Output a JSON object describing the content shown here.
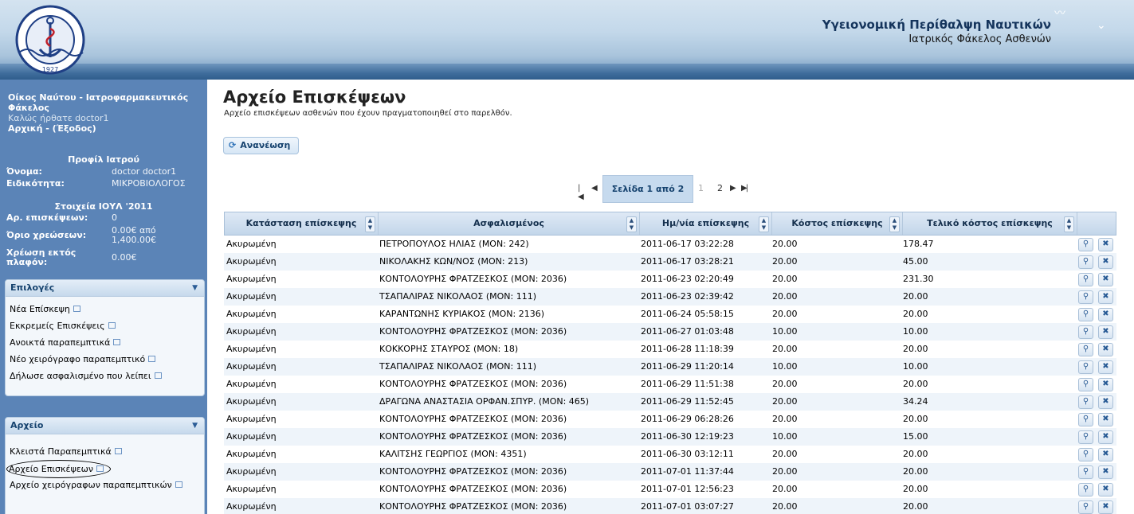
{
  "header": {
    "logo_text": "ΟΙΚΟΣ ΝΑΥΤΟΥ",
    "logo_year": "1927",
    "title": "Υγειονομική Περίθαλψη Ναυτικών",
    "subtitle": "Ιατρικός Φάκελος Ασθενών"
  },
  "sidebar": {
    "app_name": "Οίκος Ναύτου - Ιατροφαρμακευτικός Φάκελος",
    "welcome": "Καλώς ήρθατε doctor1",
    "home_link": "Αρχική",
    "logout_link": "(Έξοδος)",
    "profile_title": "Προφίλ Ιατρού",
    "profile": [
      {
        "label": "Όνομα:",
        "value": "doctor doctor1"
      },
      {
        "label": "Ειδικότητα:",
        "value": "ΜΙΚΡΟΒΙΟΛΟΓΟΣ"
      }
    ],
    "stats_title": "Στοιχεία ΙΟΥΛ '2011",
    "stats": [
      {
        "label": "Αρ. επισκέψεων:",
        "value": "0"
      },
      {
        "label": "Όριο χρεώσεων:",
        "value": "0.00€ από 1,400.00€"
      },
      {
        "label": "Χρέωση εκτός πλαφόν:",
        "value": "0.00€"
      }
    ],
    "options_panel": {
      "title": "Επιλογές",
      "items": [
        "Νέα Επίσκεψη",
        "Εκκρεμείς Επισκέψεις",
        "Ανοικτά παραπεμπτικά",
        "Νέο χειρόγραφο παραπεμπτικό",
        "Δήλωσε ασφαλισμένο που λείπει"
      ]
    },
    "archive_panel": {
      "title": "Αρχείο",
      "items": [
        "Κλειστά Παραπεμπτικά",
        "Αρχείο Επισκέψεων",
        "Αρχείο χειρόγραφων παραπεμπτικών"
      ]
    }
  },
  "main": {
    "title": "Αρχείο Επισκέψεων",
    "subtitle": "Αρχείο επισκέψεων ασθενών που έχουν πραγματοποιηθεί στο παρελθόν.",
    "refresh_label": "Ανανέωση",
    "pager": {
      "current_label": "Σελίδα 1 από 2",
      "page1": "1",
      "page2": "2"
    },
    "columns": [
      "Κατάσταση επίσκεψης",
      "Ασφαλισμένος",
      "Ημ/νία επίσκεψης",
      "Κόστος επίσκεψης",
      "Τελικό κόστος επίσκεψης"
    ],
    "rows": [
      [
        "Ακυρωμένη",
        "ΠΕΤΡΟΠΟΥΛΟΣ ΗΛΙΑΣ (ΜΟΝ: 242)",
        "2011-06-17 03:22:28",
        "20.00",
        "178.47"
      ],
      [
        "Ακυρωμένη",
        "ΝΙΚΟΛΑΚΗΣ ΚΩΝ/ΝΟΣ (ΜΟΝ: 213)",
        "2011-06-17 03:28:21",
        "20.00",
        "45.00"
      ],
      [
        "Ακυρωμένη",
        "ΚΟΝΤΟΛΟΥΡΗΣ ΦΡΑΤΖΕΣΚΟΣ (ΜΟΝ: 2036)",
        "2011-06-23 02:20:49",
        "20.00",
        "231.30"
      ],
      [
        "Ακυρωμένη",
        "ΤΣΑΠΑΛΙΡΑΣ ΝΙΚΟΛΑΟΣ (ΜΟΝ: 111)",
        "2011-06-23 02:39:42",
        "20.00",
        "20.00"
      ],
      [
        "Ακυρωμένη",
        "ΚΑΡΑΝΤΩΝΗΣ ΚΥΡΙΑΚΟΣ (ΜΟΝ: 2136)",
        "2011-06-24 05:58:15",
        "20.00",
        "20.00"
      ],
      [
        "Ακυρωμένη",
        "ΚΟΝΤΟΛΟΥΡΗΣ ΦΡΑΤΖΕΣΚΟΣ (ΜΟΝ: 2036)",
        "2011-06-27 01:03:48",
        "10.00",
        "10.00"
      ],
      [
        "Ακυρωμένη",
        "ΚΟΚΚΟΡΗΣ ΣΤΑΥΡΟΣ (ΜΟΝ: 18)",
        "2011-06-28 11:18:39",
        "20.00",
        "20.00"
      ],
      [
        "Ακυρωμένη",
        "ΤΣΑΠΑΛΙΡΑΣ ΝΙΚΟΛΑΟΣ (ΜΟΝ: 111)",
        "2011-06-29 11:20:14",
        "10.00",
        "10.00"
      ],
      [
        "Ακυρωμένη",
        "ΚΟΝΤΟΛΟΥΡΗΣ ΦΡΑΤΖΕΣΚΟΣ (ΜΟΝ: 2036)",
        "2011-06-29 11:51:38",
        "20.00",
        "20.00"
      ],
      [
        "Ακυρωμένη",
        "ΔΡΑΓΩΝΑ ΑΝΑΣΤΑΣΙΑ ΟΡΦΑΝ.ΣΠΥΡ. (ΜΟΝ: 465)",
        "2011-06-29 11:52:45",
        "20.00",
        "34.24"
      ],
      [
        "Ακυρωμένη",
        "ΚΟΝΤΟΛΟΥΡΗΣ ΦΡΑΤΖΕΣΚΟΣ (ΜΟΝ: 2036)",
        "2011-06-29 06:28:26",
        "20.00",
        "20.00"
      ],
      [
        "Ακυρωμένη",
        "ΚΟΝΤΟΛΟΥΡΗΣ ΦΡΑΤΖΕΣΚΟΣ (ΜΟΝ: 2036)",
        "2011-06-30 12:19:23",
        "10.00",
        "15.00"
      ],
      [
        "Ακυρωμένη",
        "ΚΑΛΙΤΣΗΣ ΓΕΩΡΓΙΟΣ (ΜΟΝ: 4351)",
        "2011-06-30 03:12:11",
        "20.00",
        "20.00"
      ],
      [
        "Ακυρωμένη",
        "ΚΟΝΤΟΛΟΥΡΗΣ ΦΡΑΤΖΕΣΚΟΣ (ΜΟΝ: 2036)",
        "2011-07-01 11:37:44",
        "20.00",
        "20.00"
      ],
      [
        "Ακυρωμένη",
        "ΚΟΝΤΟΛΟΥΡΗΣ ΦΡΑΤΖΕΣΚΟΣ (ΜΟΝ: 2036)",
        "2011-07-01 12:56:23",
        "20.00",
        "20.00"
      ],
      [
        "Ακυρωμένη",
        "ΚΟΝΤΟΛΟΥΡΗΣ ΦΡΑΤΖΕΣΚΟΣ (ΜΟΝ: 2036)",
        "2011-07-01 03:07:27",
        "20.00",
        "20.00"
      ]
    ],
    "row_actions": [
      "search-icon",
      "delete-icon"
    ]
  }
}
